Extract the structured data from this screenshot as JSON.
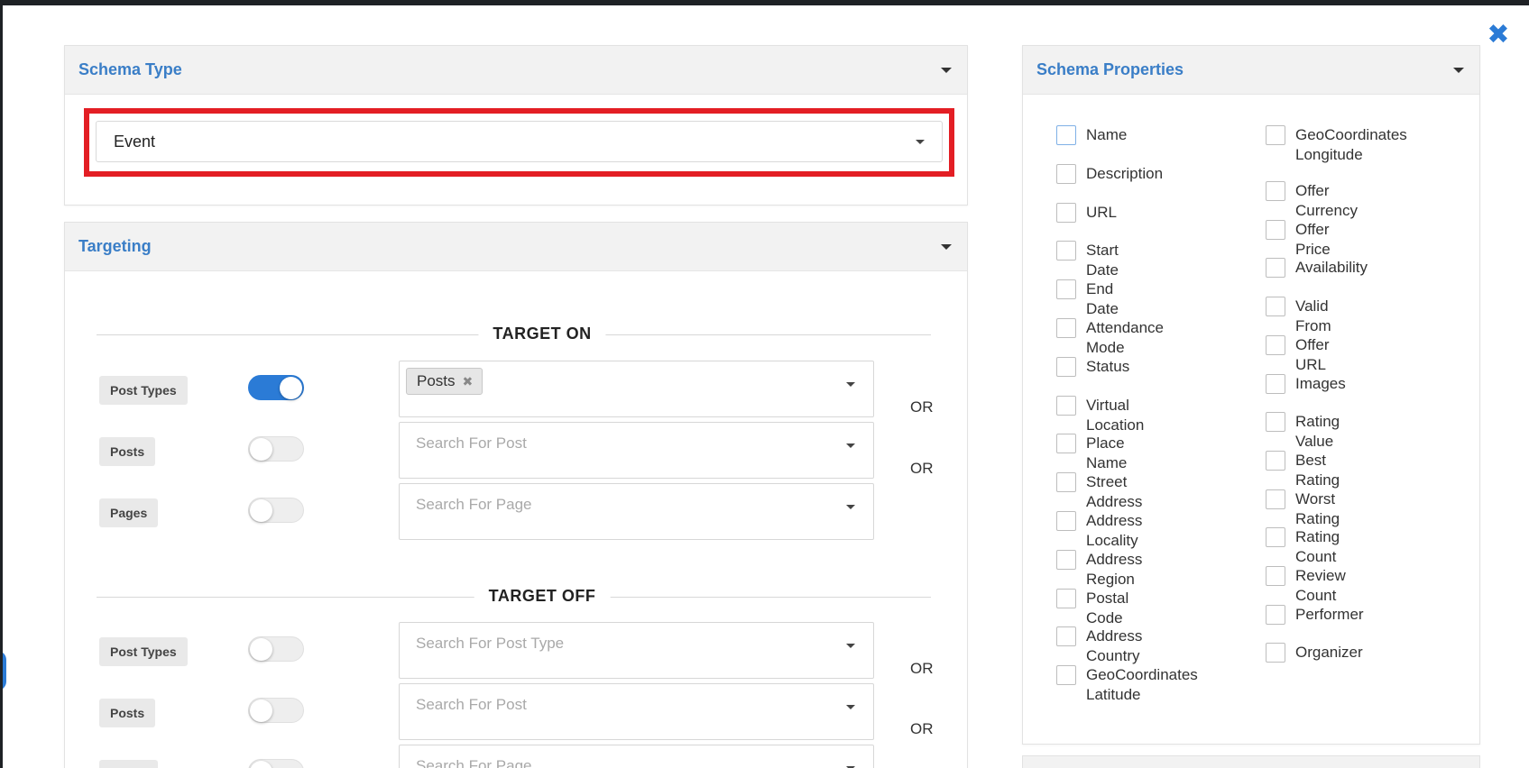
{
  "close_icon": "close-icon",
  "schema_type": {
    "title": "Schema Type",
    "selected": "Event"
  },
  "targeting": {
    "title": "Targeting",
    "target_on": {
      "heading": "TARGET ON",
      "rows": [
        {
          "label": "Post Types",
          "enabled": true,
          "tags": [
            "Posts"
          ],
          "placeholder": "",
          "or": "OR"
        },
        {
          "label": "Posts",
          "enabled": false,
          "placeholder": "Search For Post",
          "or": "OR"
        },
        {
          "label": "Pages",
          "enabled": false,
          "placeholder": "Search For Page",
          "or": ""
        }
      ]
    },
    "target_off": {
      "heading": "TARGET OFF",
      "rows": [
        {
          "label": "Post Types",
          "enabled": false,
          "placeholder": "Search For Post Type",
          "or": "OR"
        },
        {
          "label": "Posts",
          "enabled": false,
          "placeholder": "Search For Post",
          "or": "OR"
        },
        {
          "label": "Pages",
          "enabled": false,
          "placeholder": "Search For Page",
          "or": ""
        }
      ]
    }
  },
  "schema_properties": {
    "title": "Schema Properties",
    "left_column": [
      "Name",
      "Description",
      "URL",
      "Start Date",
      "End Date",
      "Attendance Mode",
      "Status",
      "Virtual Location",
      "Place Name",
      "Street Address",
      "Address Locality",
      "Address Region",
      "Postal Code",
      "Address Country",
      "GeoCoordinates Latitude"
    ],
    "right_column": [
      "GeoCoordinates Longitude",
      "Offer Currency",
      "Offer Price",
      "Availability",
      "Valid From",
      "Offer URL",
      "Images",
      "Rating Value",
      "Best Rating",
      "Worst Rating",
      "Rating Count",
      "Review Count",
      "Performer",
      "Organizer"
    ]
  },
  "colors": {
    "accent": "#2b7bd6",
    "title_blue": "#3a7ec7",
    "highlight_red": "#e31e24"
  }
}
